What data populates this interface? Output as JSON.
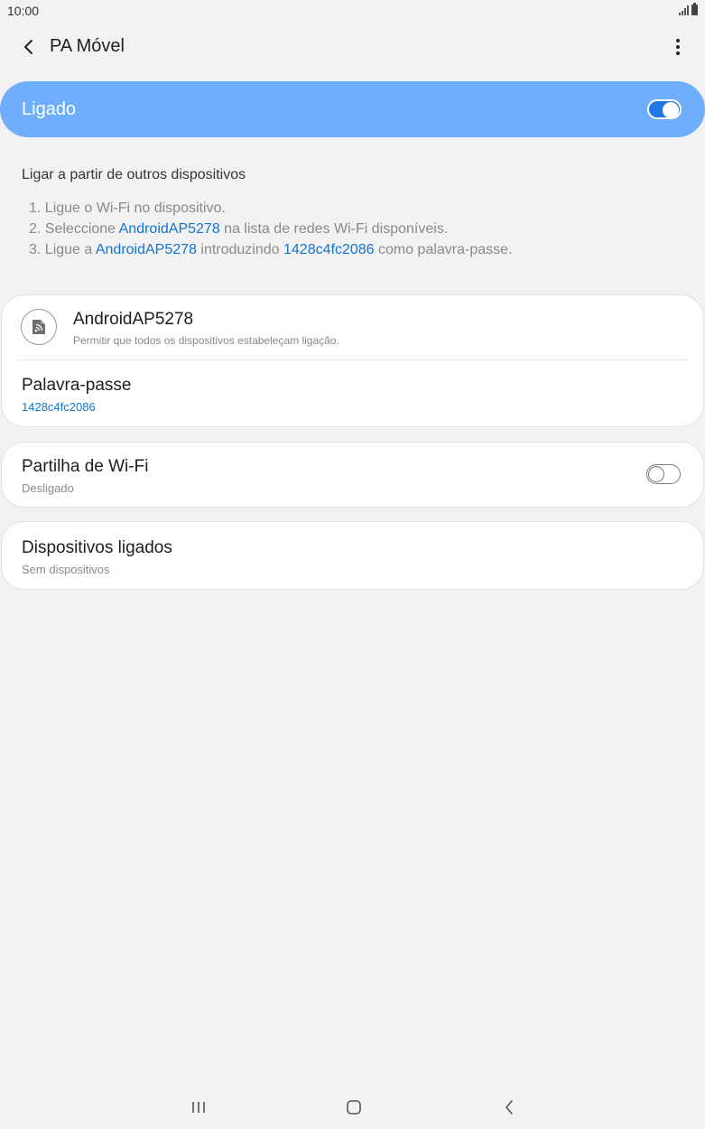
{
  "status_bar": {
    "time": "10:00",
    "icons": [
      "signal-icon",
      "battery-icon"
    ]
  },
  "app_bar": {
    "title": "PA Móvel",
    "back_icon": "chevron-left-icon",
    "more_icon": "more-vertical-icon"
  },
  "master_switch": {
    "label": "Ligado",
    "state": true,
    "color": "#6eaefc"
  },
  "instructions": {
    "title": "Ligar a partir de outros dispositivos",
    "steps": [
      {
        "prefix": "1. Ligue o Wi-Fi no dispositivo."
      },
      {
        "prefix": "2. Seleccione ",
        "network": "AndroidAP5278",
        "suffix": " na lista de redes Wi-Fi disponíveis."
      },
      {
        "prefix": "3. Ligue a ",
        "network": "AndroidAP5278",
        "middle": " introduzindo ",
        "password": "1428c4fc2086",
        "suffix": " como palavra-passe."
      }
    ]
  },
  "network": {
    "name": "AndroidAP5278",
    "description": "Permitir que todos os dispositivos estabeleçam ligação.",
    "icon": "hotspot-icon"
  },
  "password": {
    "label": "Palavra-passe",
    "value": "1428c4fc2086"
  },
  "wifi_sharing": {
    "label": "Partilha de Wi-Fi",
    "status": "Desligado",
    "state": false
  },
  "connected_devices": {
    "label": "Dispositivos ligados",
    "status": "Sem dispositivos"
  },
  "nav_bar": {
    "icons": [
      "recents-icon",
      "home-icon",
      "back-icon"
    ]
  },
  "colors": {
    "accent": "#1474d0",
    "background": "#f2f2f2"
  }
}
